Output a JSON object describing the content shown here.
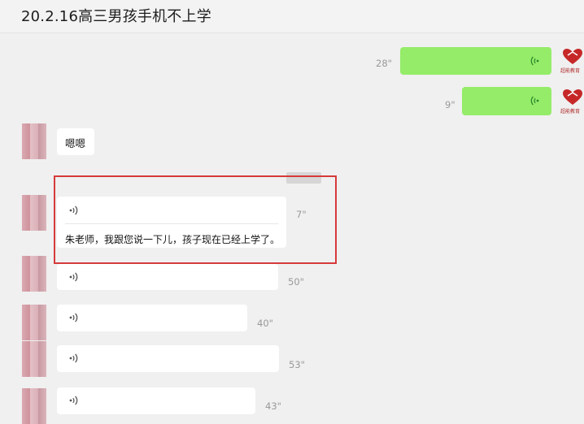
{
  "header": {
    "title": "20.2.16高三男孩手机不上学"
  },
  "brand": {
    "label": "超能教育",
    "color": "#c62828"
  },
  "accent_colors": {
    "sent_bubble": "#95ec69",
    "highlight_border": "#d63a3a",
    "wave_sent": "#2a8a2a",
    "wave_received": "#555555"
  },
  "messages": [
    {
      "sender": "me",
      "kind": "voice",
      "duration": "28\""
    },
    {
      "sender": "me",
      "kind": "voice",
      "duration": "9\""
    },
    {
      "sender": "other",
      "kind": "text",
      "text": "嗯嗯"
    },
    {
      "sender": "other",
      "kind": "voice",
      "duration": "7\"",
      "transcript": "朱老师，我跟您说一下儿，孩子现在已经上学了。",
      "highlighted": true
    },
    {
      "sender": "other",
      "kind": "voice",
      "duration": "50\""
    },
    {
      "sender": "other",
      "kind": "voice",
      "duration": "40\""
    },
    {
      "sender": "other",
      "kind": "voice",
      "duration": "53\""
    },
    {
      "sender": "other",
      "kind": "voice",
      "duration": "43\""
    }
  ]
}
